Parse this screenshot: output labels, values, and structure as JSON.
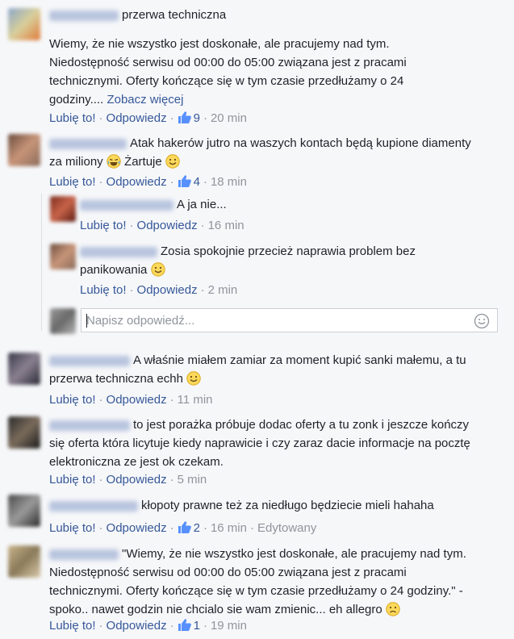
{
  "comments": [
    {
      "text": "przerwa techniczna",
      "body": [
        "Wiemy, że nie wszystko jest doskonałe, ale pracujemy nad tym.",
        "Niedostępność serwisu od 00:00 do 05:00 związana jest z pracami",
        "technicznymi. Oferty kończące się w tym czasie przedłużamy o 24",
        "godziny...."
      ],
      "see_more": "Zobacz więcej",
      "like_label": "Lubię to!",
      "reply_label": "Odpowiedz",
      "likes": "9",
      "time": "20 min"
    },
    {
      "text_line1": "Atak hakerów jutro na waszych kontach będą kupione diamenty",
      "text_line2": "za miliony",
      "text_tail": "Żartuje",
      "like_label": "Lubię to!",
      "reply_label": "Odpowiedz",
      "likes": "4",
      "time": "18 min"
    },
    {
      "text_line1": "A właśnie miałem zamiar za moment kupić sanki małemu, a tu",
      "text_line2": "przerwa techniczna echh",
      "like_label": "Lubię to!",
      "reply_label": "Odpowiedz",
      "time": "11 min"
    },
    {
      "text_line1": "to jest porażka próbuje dodac oferty a tu zonk i jeszcze kończy",
      "text_line2": "się oferta która licytuje kiedy naprawicie i czy zaraz dacie informacje na pocztę",
      "text_line3": "elektroniczna ze jest ok czekam.",
      "like_label": "Lubię to!",
      "reply_label": "Odpowiedz",
      "time": "5 min"
    },
    {
      "text": "kłopoty prawne też za niedługo będziecie mieli hahaha",
      "like_label": "Lubię to!",
      "reply_label": "Odpowiedz",
      "likes": "2",
      "time": "16 min",
      "edited": "Edytowany"
    },
    {
      "text_line1": "\"Wiemy, że nie wszystko jest doskonałe, ale pracujemy nad tym.",
      "text_line2": "Niedostępność serwisu od 00:00 do 05:00 związana jest z pracami",
      "text_line3": "technicznymi. Oferty kończące się w tym czasie przedłużamy o 24 godziny.\" -",
      "text_line4": "spoko.. nawet godzin nie chcialo sie wam zmienic... eh allegro",
      "like_label": "Lubię to!",
      "reply_label": "Odpowiedz",
      "likes": "1",
      "time": "19 min"
    }
  ],
  "replies": [
    {
      "text": "A ja nie...",
      "like_label": "Lubię to!",
      "reply_label": "Odpowiedz",
      "time": "16 min"
    },
    {
      "text_line1": "Zosia spokojnie przecież naprawia problem bez",
      "text_line2": "panikowania",
      "like_label": "Lubię to!",
      "reply_label": "Odpowiedz",
      "time": "2 min"
    }
  ],
  "reply_box": {
    "placeholder": "Napisz odpowiedź..."
  },
  "colors": {
    "link": "#365899",
    "meta": "#90949c",
    "text": "#1d2129",
    "background": "#f6f7f9"
  },
  "icons": {
    "like": "thumbs-up-icon",
    "emoji_tears": "laughing-tears-emoji",
    "emoji_smile": "smile-emoji",
    "emoji_sad": "sad-emoji",
    "reply_emoji": "smiley-outline-icon"
  }
}
